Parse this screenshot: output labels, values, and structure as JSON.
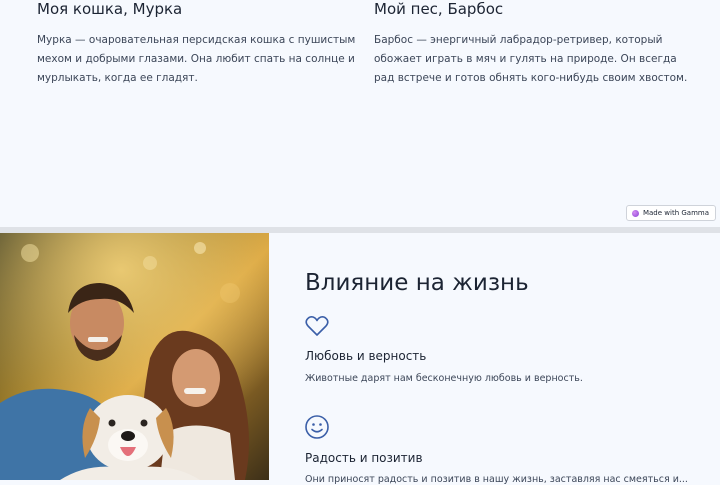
{
  "pets": [
    {
      "title": "Моя кошка, Мурка",
      "text": "Мурка — очаровательная персидская кошка с пушистым мехом и добрыми глазами. Она любит спать на солнце и мурлыкать, когда ее гладят."
    },
    {
      "title": "Мой пес, Барбос",
      "text": "Барбос — энергичный лабрадор-ретривер, который обожает играть в мяч и гулять на природе. Он всегда рад встрече и готов обнять кого-нибудь своим хвостом."
    }
  ],
  "badge": {
    "label": "Made with Gamma"
  },
  "section": {
    "title": "Влияние на жизнь",
    "features": [
      {
        "icon": "heart-icon",
        "title": "Любовь и верность",
        "text": "Животные дарят нам бесконечную любовь и верность."
      },
      {
        "icon": "smile-icon",
        "title": "Радость и позитив",
        "text": "Они приносят радость и позитив в нашу жизнь, заставляя нас смеяться и..."
      }
    ]
  },
  "colors": {
    "accent": "#3b5fa8",
    "background": "#f6f9fe",
    "text": "#1c2433"
  }
}
